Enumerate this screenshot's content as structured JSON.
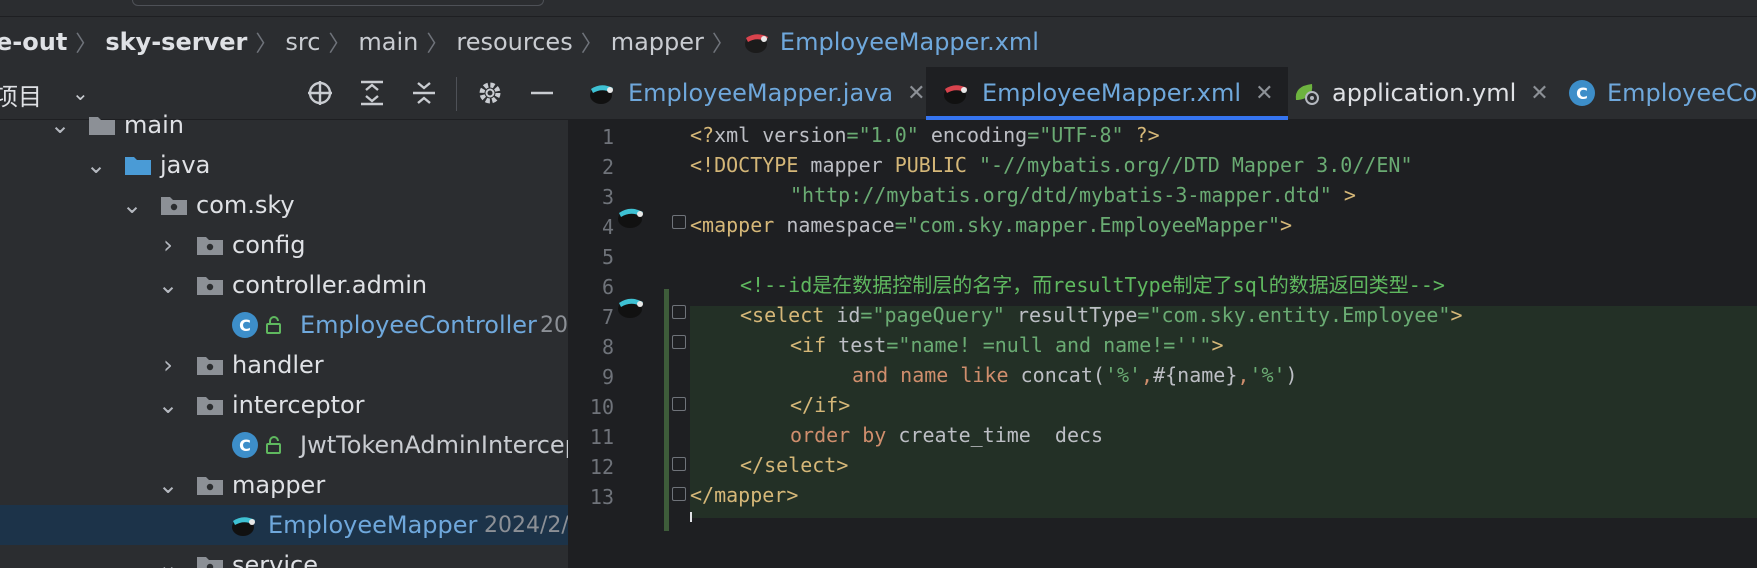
{
  "breadcrumb": {
    "items": [
      "e-out",
      "sky-server",
      "src",
      "main",
      "resources",
      "mapper",
      "EmployeeMapper.xml"
    ]
  },
  "sidebar": {
    "title": "项目",
    "tree": [
      {
        "label": "main",
        "type": "folder"
      },
      {
        "label": "java",
        "type": "folder-source"
      },
      {
        "label": "com.sky",
        "type": "package"
      },
      {
        "label": "config",
        "type": "package"
      },
      {
        "label": "controller.admin",
        "type": "package"
      },
      {
        "label": "EmployeeController",
        "type": "class",
        "date": "20"
      },
      {
        "label": "handler",
        "type": "package"
      },
      {
        "label": "interceptor",
        "type": "package"
      },
      {
        "label": "JwtTokenAdminIntercep",
        "type": "class"
      },
      {
        "label": "mapper",
        "type": "package"
      },
      {
        "label": "EmployeeMapper",
        "type": "mybatis-mapper",
        "date": "2024/2/"
      },
      {
        "label": "service",
        "type": "package"
      }
    ]
  },
  "tabs": [
    {
      "label": "EmployeeMapper.java",
      "active": false,
      "icon": "mybatis-java-icon"
    },
    {
      "label": "EmployeeMapper.xml",
      "active": true,
      "icon": "mybatis-xml-icon"
    },
    {
      "label": "application.yml",
      "active": false,
      "icon": "spring-config-icon"
    },
    {
      "label": "EmployeeCon",
      "active": false,
      "icon": "class-icon"
    }
  ],
  "editor": {
    "line_numbers": [
      "1",
      "2",
      "3",
      "4",
      "5",
      "6",
      "7",
      "8",
      "9",
      "10",
      "11",
      "12",
      "13"
    ],
    "lines": {
      "l1": {
        "a": "<?",
        "b": "xml version",
        "c": "=",
        "d": "\"1.0\"",
        "e": " encoding",
        "f": "=",
        "g": "\"UTF-8\"",
        "h": " ?>"
      },
      "l2": {
        "a": "<!DOCTYPE ",
        "b": "mapper ",
        "c": "PUBLIC ",
        "d": "\"-//mybatis.org//DTD Mapper 3.0//EN\""
      },
      "l3": {
        "a": "\"http://mybatis.org/dtd/mybatis-3-mapper.dtd\"",
        "b": " >"
      },
      "l4": {
        "a": "<",
        "b": "mapper",
        "c": " namespace",
        "d": "=",
        "e": "\"com.sky.mapper.EmployeeMapper\"",
        "f": ">"
      },
      "l6": {
        "a": "<!--id是在数据控制层的名字，而resultType制定了sql的数据返回类型-->"
      },
      "l7": {
        "a": "<",
        "b": "select",
        "c": " id",
        "d": "=",
        "e": "\"pageQuery\"",
        "f": " resultType",
        "g": "=",
        "h": "\"com.sky.entity.Employee\"",
        "i": ">"
      },
      "l8": {
        "a": "<",
        "b": "if",
        "c": " test",
        "d": "=",
        "e": "\"name! =null and name!=''\"",
        "f": ">"
      },
      "l9": {
        "a": "and ",
        "b": "name ",
        "c": "like ",
        "d": "concat(",
        "e": "'%'",
        "f": ",",
        "g": "#{name}",
        "h": ",",
        "i": "'%'",
        "j": ")"
      },
      "l10": {
        "a": "</",
        "b": "if",
        "c": ">"
      },
      "l11": {
        "a": "order ",
        "b": "by ",
        "c": "create_time  decs"
      },
      "l12": {
        "a": "</",
        "b": "select",
        "c": ">"
      },
      "l13": {
        "a": "</",
        "b": "mapper",
        "c": ">"
      }
    }
  }
}
